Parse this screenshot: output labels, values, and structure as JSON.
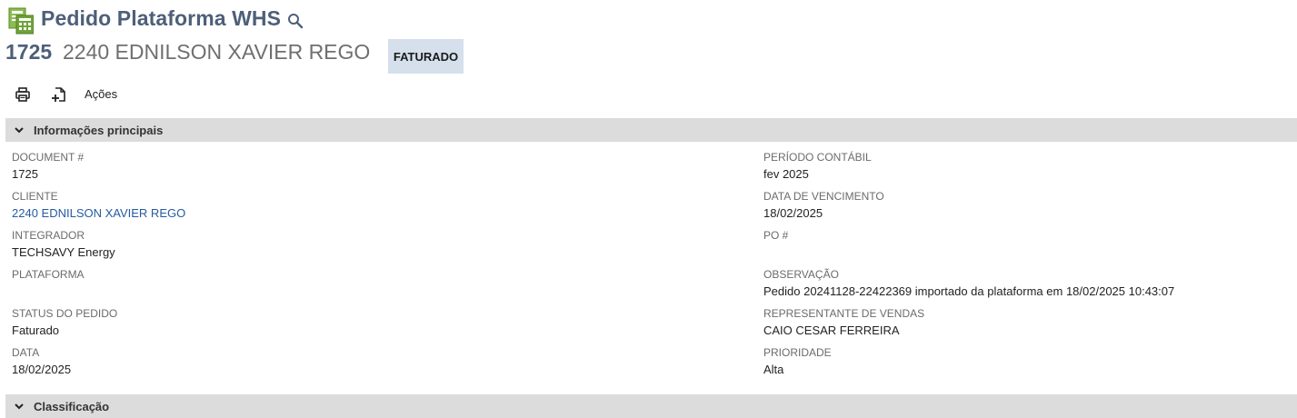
{
  "header": {
    "title": "Pedido Plataforma WHS",
    "record_id": "1725",
    "record_name": "2240 EDNILSON XAVIER REGO",
    "status_badge": "FATURADO",
    "record_icon": "spreadsheet-record-icon",
    "search_icon": "search-icon"
  },
  "toolbar": {
    "print_icon": "print-icon",
    "new_document_icon": "new-document-icon",
    "actions_label": "Ações"
  },
  "sections": {
    "main_title": "Informações principais",
    "classification_title": "Classificação"
  },
  "fields_left": [
    {
      "label": "DOCUMENT #",
      "value": "1725"
    },
    {
      "label": "CLIENTE",
      "value": "2240 EDNILSON XAVIER REGO"
    },
    {
      "label": "INTEGRADOR",
      "value": "TECHSAVY Energy"
    },
    {
      "label": "PLATAFORMA",
      "value": ""
    },
    {
      "label": "STATUS DO PEDIDO",
      "value": "Faturado"
    },
    {
      "label": "DATA",
      "value": "18/02/2025"
    }
  ],
  "fields_right": [
    {
      "label": "PERÍODO CONTÁBIL",
      "value": "fev 2025"
    },
    {
      "label": "DATA DE VENCIMENTO",
      "value": "18/02/2025"
    },
    {
      "label": "PO #",
      "value": ""
    },
    {
      "label": "OBSERVAÇÃO",
      "value": "Pedido 20241128-22422369 importado da plataforma em 18/02/2025 10:43:07"
    },
    {
      "label": "REPRESENTANTE DE VENDAS",
      "value": "CAIO CESAR FERREIRA"
    },
    {
      "label": "PRIORIDADE",
      "value": "Alta"
    }
  ],
  "colors": {
    "title": "#4d5f79",
    "badge_bg": "#d5e0ec",
    "section_bg": "#dcdcdc",
    "link": "#255ba0",
    "record_icon_green": "#6fa33a"
  }
}
